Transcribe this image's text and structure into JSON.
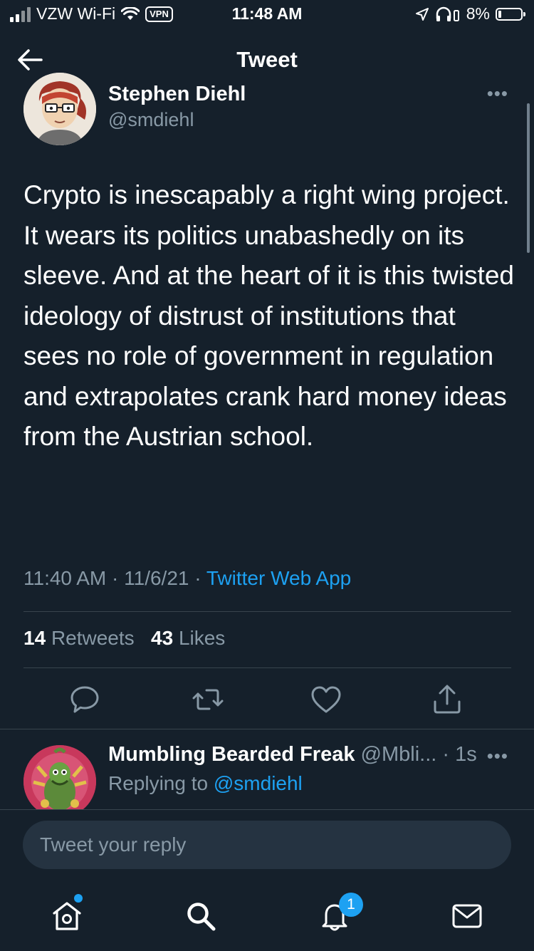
{
  "status_bar": {
    "carrier": "VZW Wi-Fi",
    "vpn": "VPN",
    "time": "11:48 AM",
    "battery": "8%",
    "battery_level": 0.08
  },
  "header": {
    "title": "Tweet",
    "icon": "back-arrow-icon"
  },
  "tweet": {
    "author_name": "Stephen Diehl",
    "author_handle": "@smdiehl",
    "text": "Crypto is inescapably a right wing project. It wears its politics unabashedly on its sleeve. And at the heart of it is this twisted ideology of distrust of institutions that sees no role of government in regulation and extrapolates crank hard money ideas from the Austrian school.",
    "time": "11:40 AM",
    "date": "11/6/21",
    "separator": "·",
    "source": "Twitter Web App",
    "retweets_count": "14",
    "retweets_label": "Retweets",
    "likes_count": "43",
    "likes_label": "Likes",
    "more": "•••"
  },
  "reply": {
    "author_name": "Mumbling Bearded Freak",
    "author_handle": "@Mbli...",
    "age": "· 1s",
    "replying_prefix": "Replying to",
    "replying_to": "@smdiehl",
    "more": "•••"
  },
  "composer": {
    "placeholder": "Tweet your reply"
  },
  "tabbar": {
    "notifications_badge": "1"
  },
  "colors": {
    "background": "#15202b",
    "accent": "#1da1f2",
    "muted": "#8899a6",
    "divider": "#38444d"
  }
}
